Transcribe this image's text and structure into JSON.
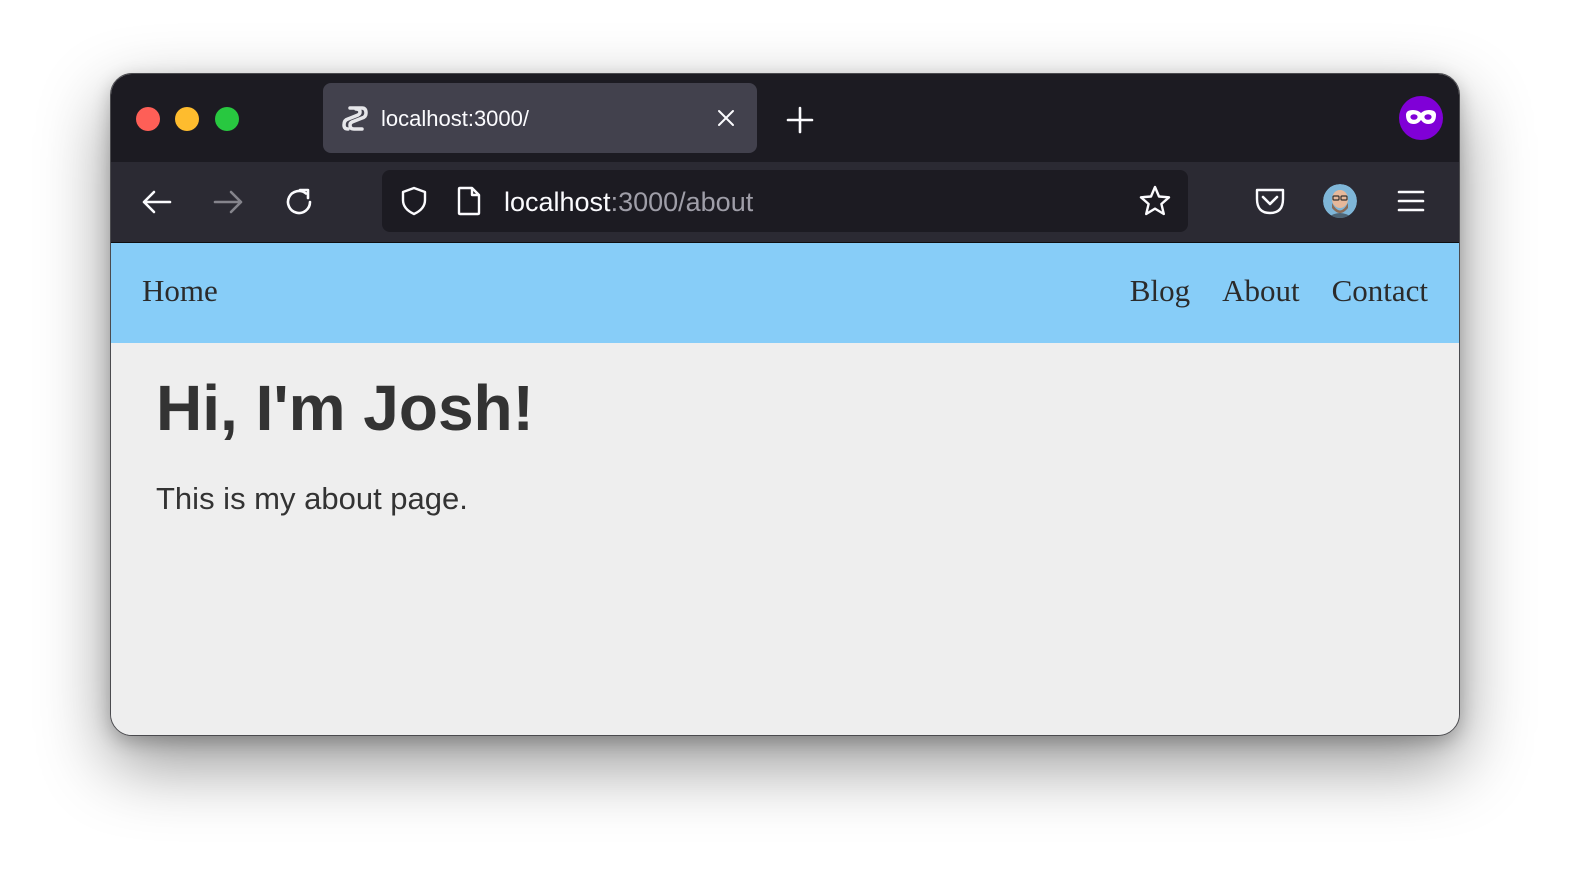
{
  "browser": {
    "tab": {
      "title": "localhost:3000/"
    },
    "address_bar": {
      "host": "localhost",
      "path": ":3000/about"
    }
  },
  "icons": {
    "tab_favicon": "svelte-logo-icon",
    "extension": "private-browsing-mask-icon",
    "back": "arrow-left-icon",
    "forward": "arrow-right-icon",
    "reload": "reload-icon",
    "tracking": "shield-icon",
    "page_info": "page-icon",
    "bookmark": "star-icon",
    "pocket": "pocket-icon",
    "account": "avatar",
    "menu": "hamburger-menu-icon",
    "new_tab": "plus-icon",
    "close_tab": "close-icon"
  },
  "site_nav": {
    "home": "Home",
    "links": [
      "Blog",
      "About",
      "Contact"
    ]
  },
  "page": {
    "heading": "Hi, I'm Josh!",
    "text": "This is my about page."
  },
  "colors": {
    "site_nav_bg": "#87cdf8",
    "page_bg": "#eeeeee",
    "browser_chrome": "#1c1b22",
    "toolbar": "#2b2a33",
    "active_tab": "#42414d",
    "private_mask": "#8000d7"
  }
}
